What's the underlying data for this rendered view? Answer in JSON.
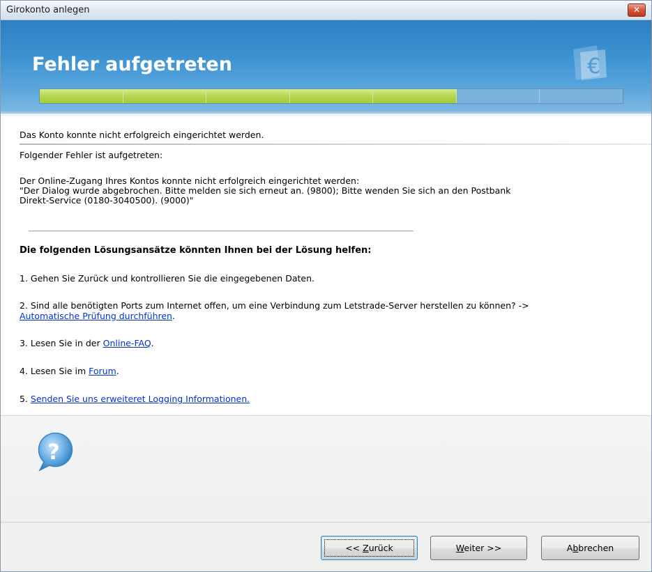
{
  "window": {
    "title": "Girokonto anlegen",
    "close_label": "✕"
  },
  "header": {
    "title": "Fehler aufgetreten"
  },
  "progress": {
    "total_steps": 7,
    "completed_steps": 5
  },
  "content": {
    "line1": "Das Konto konnte nicht erfolgreich eingerichtet werden.",
    "line2": "Folgender Fehler ist aufgetreten:",
    "error_lines": [
      "Der Online-Zugang Ihres Kontos konnte nicht erfolgreich eingerichtet werden:",
      "\"Der Dialog wurde abgebrochen. Bitte melden sie sich erneut an. (9800); Bitte wenden Sie sich an den Postbank",
      "Direkt-Service (0180-3040500). (9000)\""
    ],
    "solutions_heading": "Die folgenden Lösungsansätze könnten Ihnen bei der Lösung helfen:",
    "solution1": "1. Gehen Sie Zurück und kontrollieren Sie die eingegebenen Daten.",
    "solution2_text": "2. Sind alle benötigten Ports zum Internet offen, um eine Verbindung zum Letstrade-Server herstellen zu können? ->",
    "solution2_link": "Automatische Prüfung durchführen",
    "solution2_after": ".",
    "solution3_text": "3. Lesen Sie in der ",
    "solution3_link": "Online-FAQ",
    "solution3_after": ".",
    "solution4_text": "4. Lesen Sie im ",
    "solution4_link": "Forum",
    "solution4_after": ".",
    "solution5_text": "5. ",
    "solution5_link": "Senden Sie uns erweiteret Logging Informationen."
  },
  "buttons": {
    "back": {
      "prefix": "<< ",
      "mnemonic": "Z",
      "rest": "urück"
    },
    "next": {
      "mnemonic": "W",
      "rest": "eiter >>"
    },
    "cancel": {
      "before": "A",
      "mnemonic": "b",
      "rest": "brechen"
    }
  },
  "colors": {
    "header_blue": "#3c92d1",
    "progress_green": "#b4d84e",
    "link": "#0033cc"
  }
}
